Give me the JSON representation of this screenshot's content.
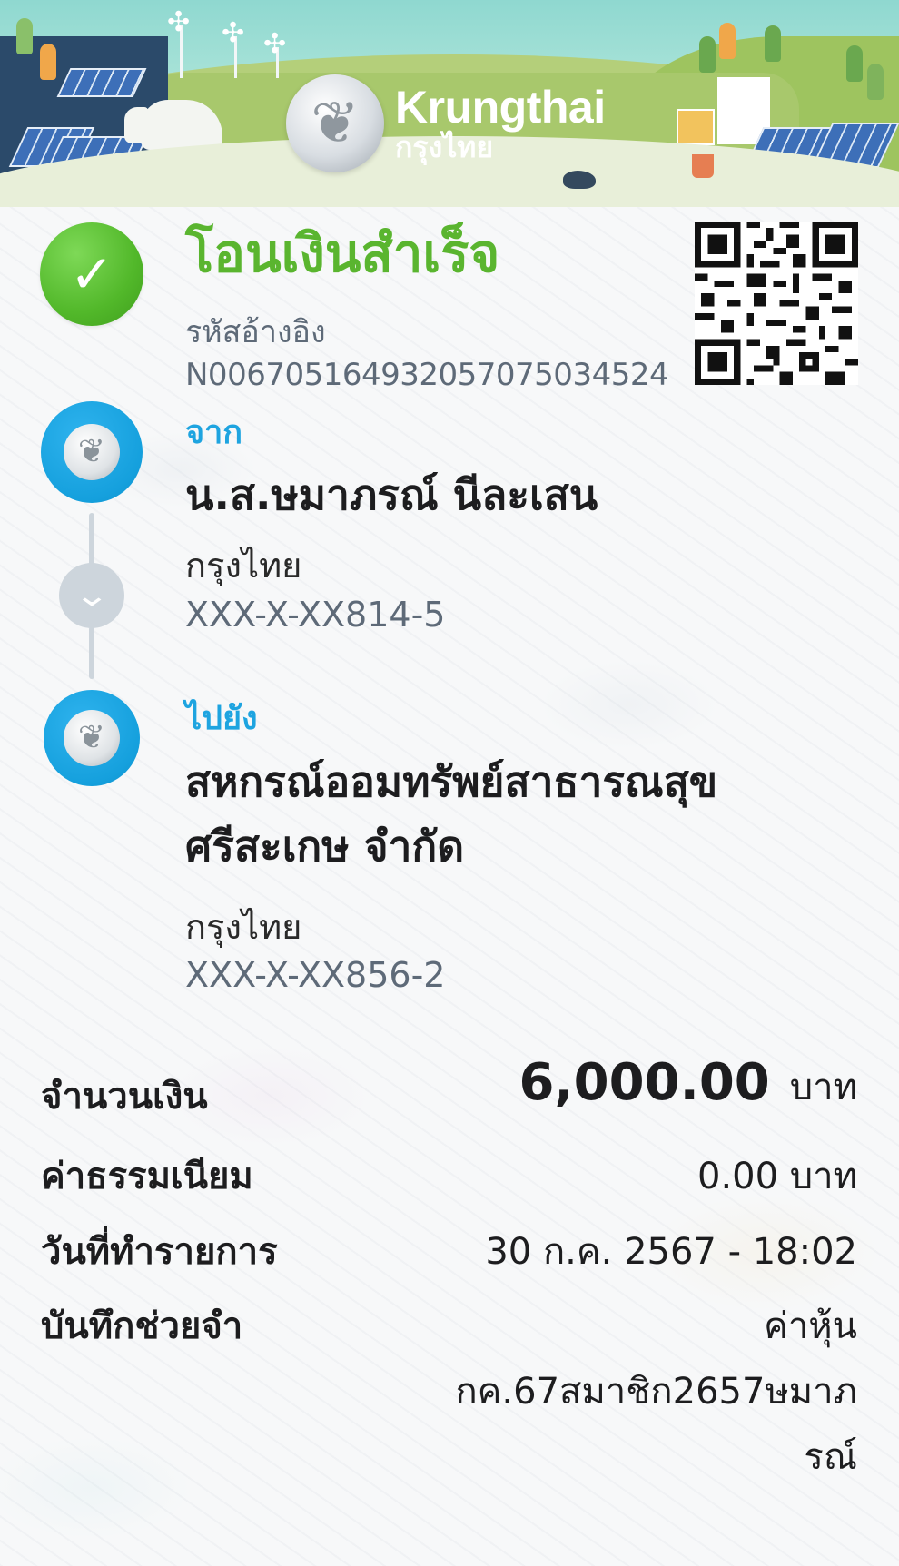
{
  "header": {
    "brand_en": "Krungthai",
    "brand_th": "กรุงไทย"
  },
  "status": {
    "title": "โอนเงินสำเร็จ",
    "ref_label": "รหัสอ้างอิง",
    "ref_value": "N006705164932057075034524"
  },
  "from": {
    "label": "จาก",
    "name": "น.ส.ษมาภรณ์ นีละเสน",
    "bank": "กรุงไทย",
    "account": "XXX-X-XX814-5"
  },
  "to": {
    "label": "ไปยัง",
    "name": "สหกรณ์ออมทรัพย์สาธารณสุขศรีสะเกษ จำกัด",
    "bank": "กรุงไทย",
    "account": "XXX-X-XX856-2"
  },
  "details": {
    "amount_label": "จำนวนเงิน",
    "amount_value": "6,000.00",
    "amount_unit": "บาท",
    "fee_label": "ค่าธรรมเนียม",
    "fee_value": "0.00 บาท",
    "date_label": "วันที่ทำรายการ",
    "date_value": "30 ก.ค. 2567 - 18:02",
    "memo_label": "บันทึกช่วยจำ",
    "memo_value": "ค่าหุ้น กค.67สมาชิก2657ษมาภรณ์"
  },
  "icons": {
    "success": "check-icon",
    "bank_logo": "krungthai-logo-icon",
    "connector": "chevron-down-icon",
    "qr": "qr-code-icon"
  },
  "colors": {
    "success_green": "#5ab52f",
    "accent_blue": "#1ea4e0",
    "muted_text": "#5e6a78"
  }
}
